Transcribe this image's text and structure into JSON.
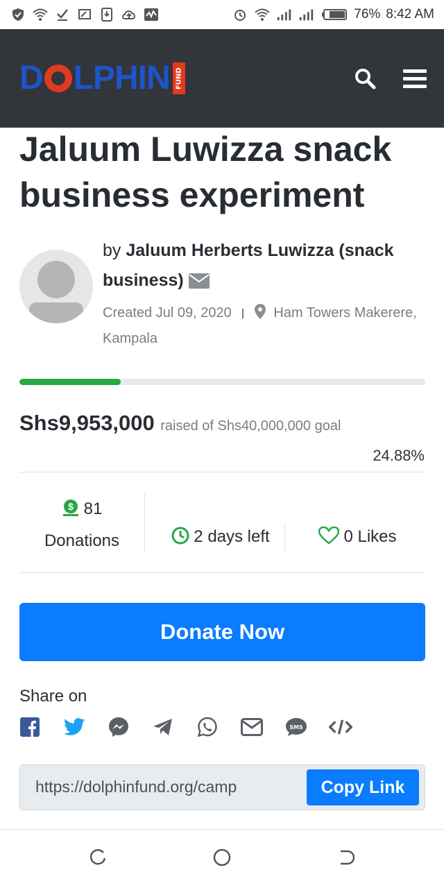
{
  "status_bar": {
    "battery": "76%",
    "time": "8:42 AM"
  },
  "header": {
    "logo_text_left": "D",
    "logo_text_right": "LPHIN",
    "logo_badge": "FUND"
  },
  "campaign": {
    "title": "Jaluum Luwizza snack business experiment",
    "by_prefix": "by",
    "author": "Jaluum Herberts Luwizza (snack business)",
    "created": "Created Jul 09, 2020",
    "location": "Ham Towers Makerere, Kampala"
  },
  "funding": {
    "raised": "Shs9,953,000",
    "goal_text": "raised of Shs40,000,000 goal",
    "percent_text": "24.88%",
    "progress": 0.2488
  },
  "stats": {
    "donations_count": "81",
    "donations_label": "Donations",
    "days_left": "2 days left",
    "likes": "0 Likes"
  },
  "donate_label": "Donate Now",
  "share": {
    "label": "Share on",
    "icons": [
      "facebook-icon",
      "twitter-icon",
      "messenger-icon",
      "telegram-icon",
      "whatsapp-icon",
      "email-icon",
      "sms-icon",
      "embed-icon"
    ]
  },
  "link": {
    "url": "https://dolphinfund.org/camp",
    "copy_label": "Copy Link"
  },
  "colors": {
    "header_bg": "#32353a",
    "brand_blue": "#1d54c9",
    "brand_red": "#e23a1e",
    "primary": "#0a7cff",
    "success": "#28a745"
  }
}
